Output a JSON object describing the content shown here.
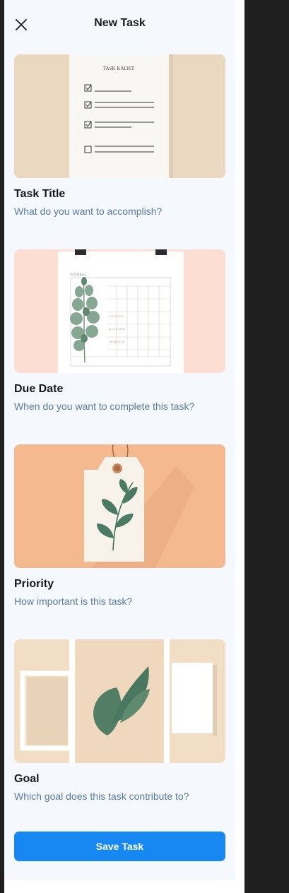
{
  "header": {
    "title": "New Task",
    "close_icon": "close-icon"
  },
  "sections": [
    {
      "title": "Task Title",
      "subtitle": "What do you want to accomplish?",
      "image_label": "TASK KALIST"
    },
    {
      "title": "Due Date",
      "subtitle": "When do you want to complete this task?",
      "image_label": "KANIKAL"
    },
    {
      "title": "Priority",
      "subtitle": "How important is this task?"
    },
    {
      "title": "Goal",
      "subtitle": "Which goal does this task contribute to?"
    }
  ],
  "actions": {
    "save_label": "Save Task"
  },
  "colors": {
    "background": "#f5f9fd",
    "accent": "#1787f1",
    "subtitle": "#5879a3",
    "title": "#17191c"
  }
}
